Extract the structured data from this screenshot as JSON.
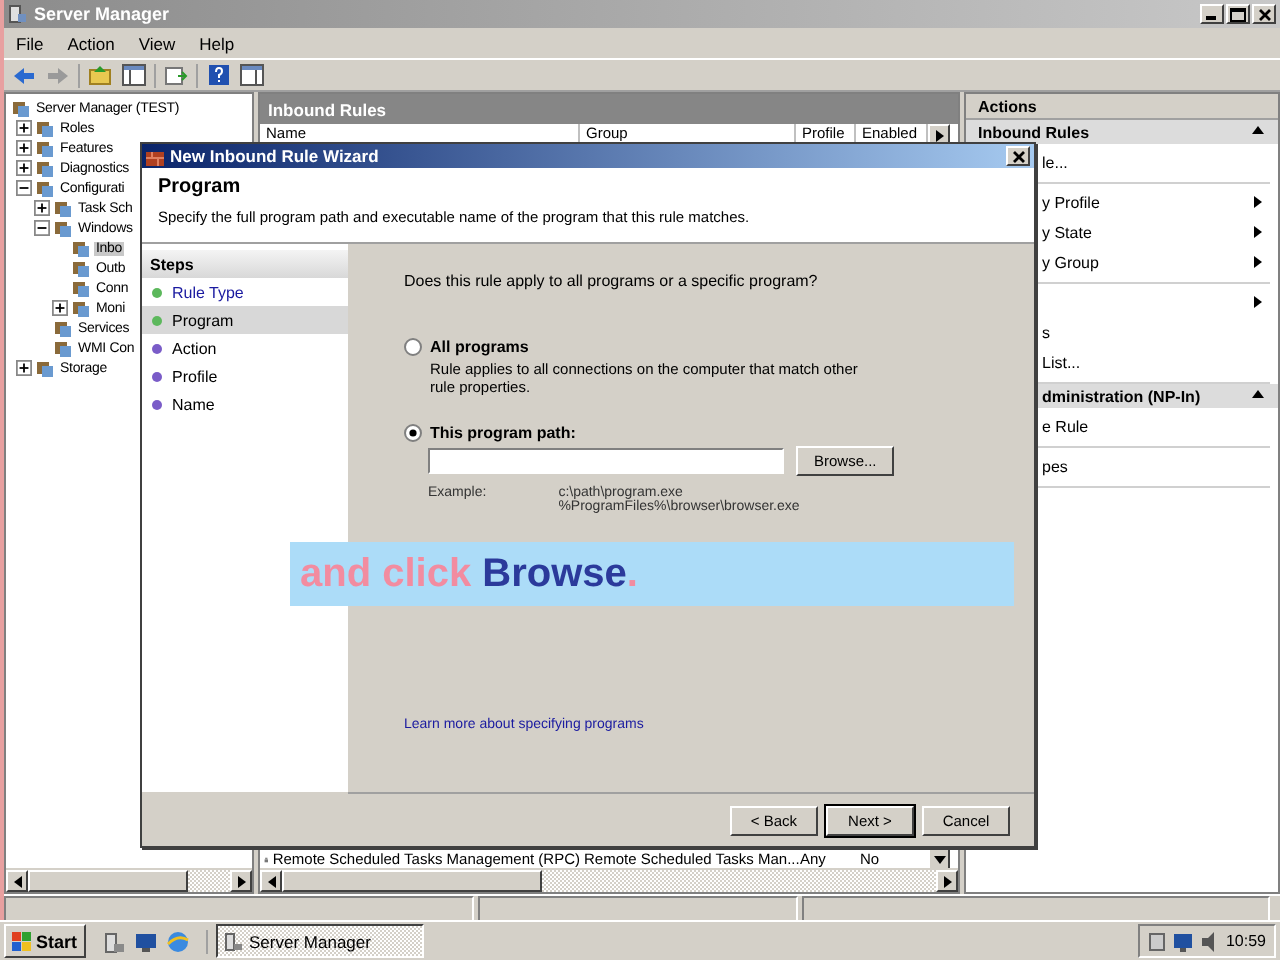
{
  "window": {
    "title": "Server Manager"
  },
  "menu": [
    "File",
    "Action",
    "View",
    "Help"
  ],
  "tree": [
    {
      "label": "Server Manager (TEST)",
      "selected": false,
      "children": [
        {
          "label": "Roles",
          "expanded": false,
          "selected": false
        },
        {
          "label": "Features",
          "expanded": false,
          "selected": false
        },
        {
          "label": "Diagnostics",
          "expanded": false,
          "selected": false
        },
        {
          "label": "Configurati",
          "expanded": true,
          "selected": false,
          "children": [
            {
              "label": "Task Sch",
              "expanded": false,
              "selected": false
            },
            {
              "label": "Windows",
              "expanded": true,
              "selected": false,
              "children": [
                {
                  "label": "Inbo",
                  "selected": true
                },
                {
                  "label": "Outb",
                  "selected": false
                },
                {
                  "label": "Conn",
                  "selected": false
                },
                {
                  "label": "Moni",
                  "expanded": false,
                  "selected": false
                }
              ]
            },
            {
              "label": "Services",
              "selected": false
            },
            {
              "label": "WMI Con",
              "selected": false
            }
          ]
        },
        {
          "label": "Storage",
          "expanded": false,
          "selected": false
        }
      ]
    }
  ],
  "center": {
    "title": "Inbound Rules",
    "columns": [
      "Name",
      "Group",
      "Profile",
      "Enabled"
    ],
    "rows": [
      {
        "cells": [
          "Remote Scheduled Tasks Management (RPC)",
          "Remote Scheduled Tasks Man...",
          "Any",
          "No"
        ]
      }
    ]
  },
  "actions": {
    "title": "Actions",
    "sections": [
      {
        "title": "Inbound Rules",
        "expanded": true,
        "groups": [
          [
            {
              "label": "le...",
              "submenu": false
            }
          ],
          [
            {
              "label": "y Profile",
              "submenu": true
            },
            {
              "label": "y State",
              "submenu": true
            },
            {
              "label": "y Group",
              "submenu": true
            }
          ],
          [
            {
              "submenu": true
            },
            {
              "label": "s",
              "submenu": false
            },
            {
              "label": "List...",
              "submenu": false
            }
          ]
        ]
      },
      {
        "title": "dministration (NP-In)",
        "expanded": true,
        "groups": [
          [
            {
              "label": "e Rule",
              "submenu": false
            }
          ],
          [
            {
              "label": "pes",
              "submenu": false
            }
          ]
        ]
      }
    ]
  },
  "wizard": {
    "title": "New Inbound Rule Wizard",
    "heading": "Program",
    "description": "Specify the full program path and executable name of the program that this rule matches.",
    "steps_title": "Steps",
    "steps": [
      {
        "label": "Rule Type",
        "selected": false,
        "completed": true,
        "color": "#5cb85c"
      },
      {
        "label": "Program",
        "selected": true,
        "completed": false,
        "color": "#5cb85c"
      },
      {
        "label": "Action",
        "selected": false,
        "completed": false,
        "color": "#7a5cc8"
      },
      {
        "label": "Profile",
        "selected": false,
        "completed": false,
        "color": "#7a5cc8"
      },
      {
        "label": "Name",
        "selected": false,
        "completed": false,
        "color": "#7a5cc8"
      }
    ],
    "question": "Does this rule apply to all programs or a specific program?",
    "options": [
      {
        "label": "All programs",
        "description": "Rule applies to all connections on the computer that match other rule properties.",
        "selected": false
      },
      {
        "label": "This program path:",
        "selected": true,
        "browse": "Browse...",
        "example_label": "Example:",
        "examples": [
          "c:\\path\\program.exe",
          "%ProgramFiles%\\browser\\browser.exe"
        ]
      }
    ],
    "link": "Learn more about specifying programs",
    "buttons": [
      {
        "label": "< Back",
        "default": false
      },
      {
        "label": "Next >",
        "default": true
      },
      {
        "label": "Cancel",
        "default": false
      }
    ]
  },
  "caption": {
    "parts": [
      {
        "text": "and click ",
        "color": "#f28ca0"
      },
      {
        "text": "Browse",
        "color": "#2b3a9b"
      },
      {
        "text": ".",
        "color": "#f28ca0"
      }
    ]
  },
  "taskbar": {
    "start": "Start",
    "tasks": [
      {
        "label": "Server Manager",
        "selected": true
      }
    ],
    "clock": "10:59"
  }
}
